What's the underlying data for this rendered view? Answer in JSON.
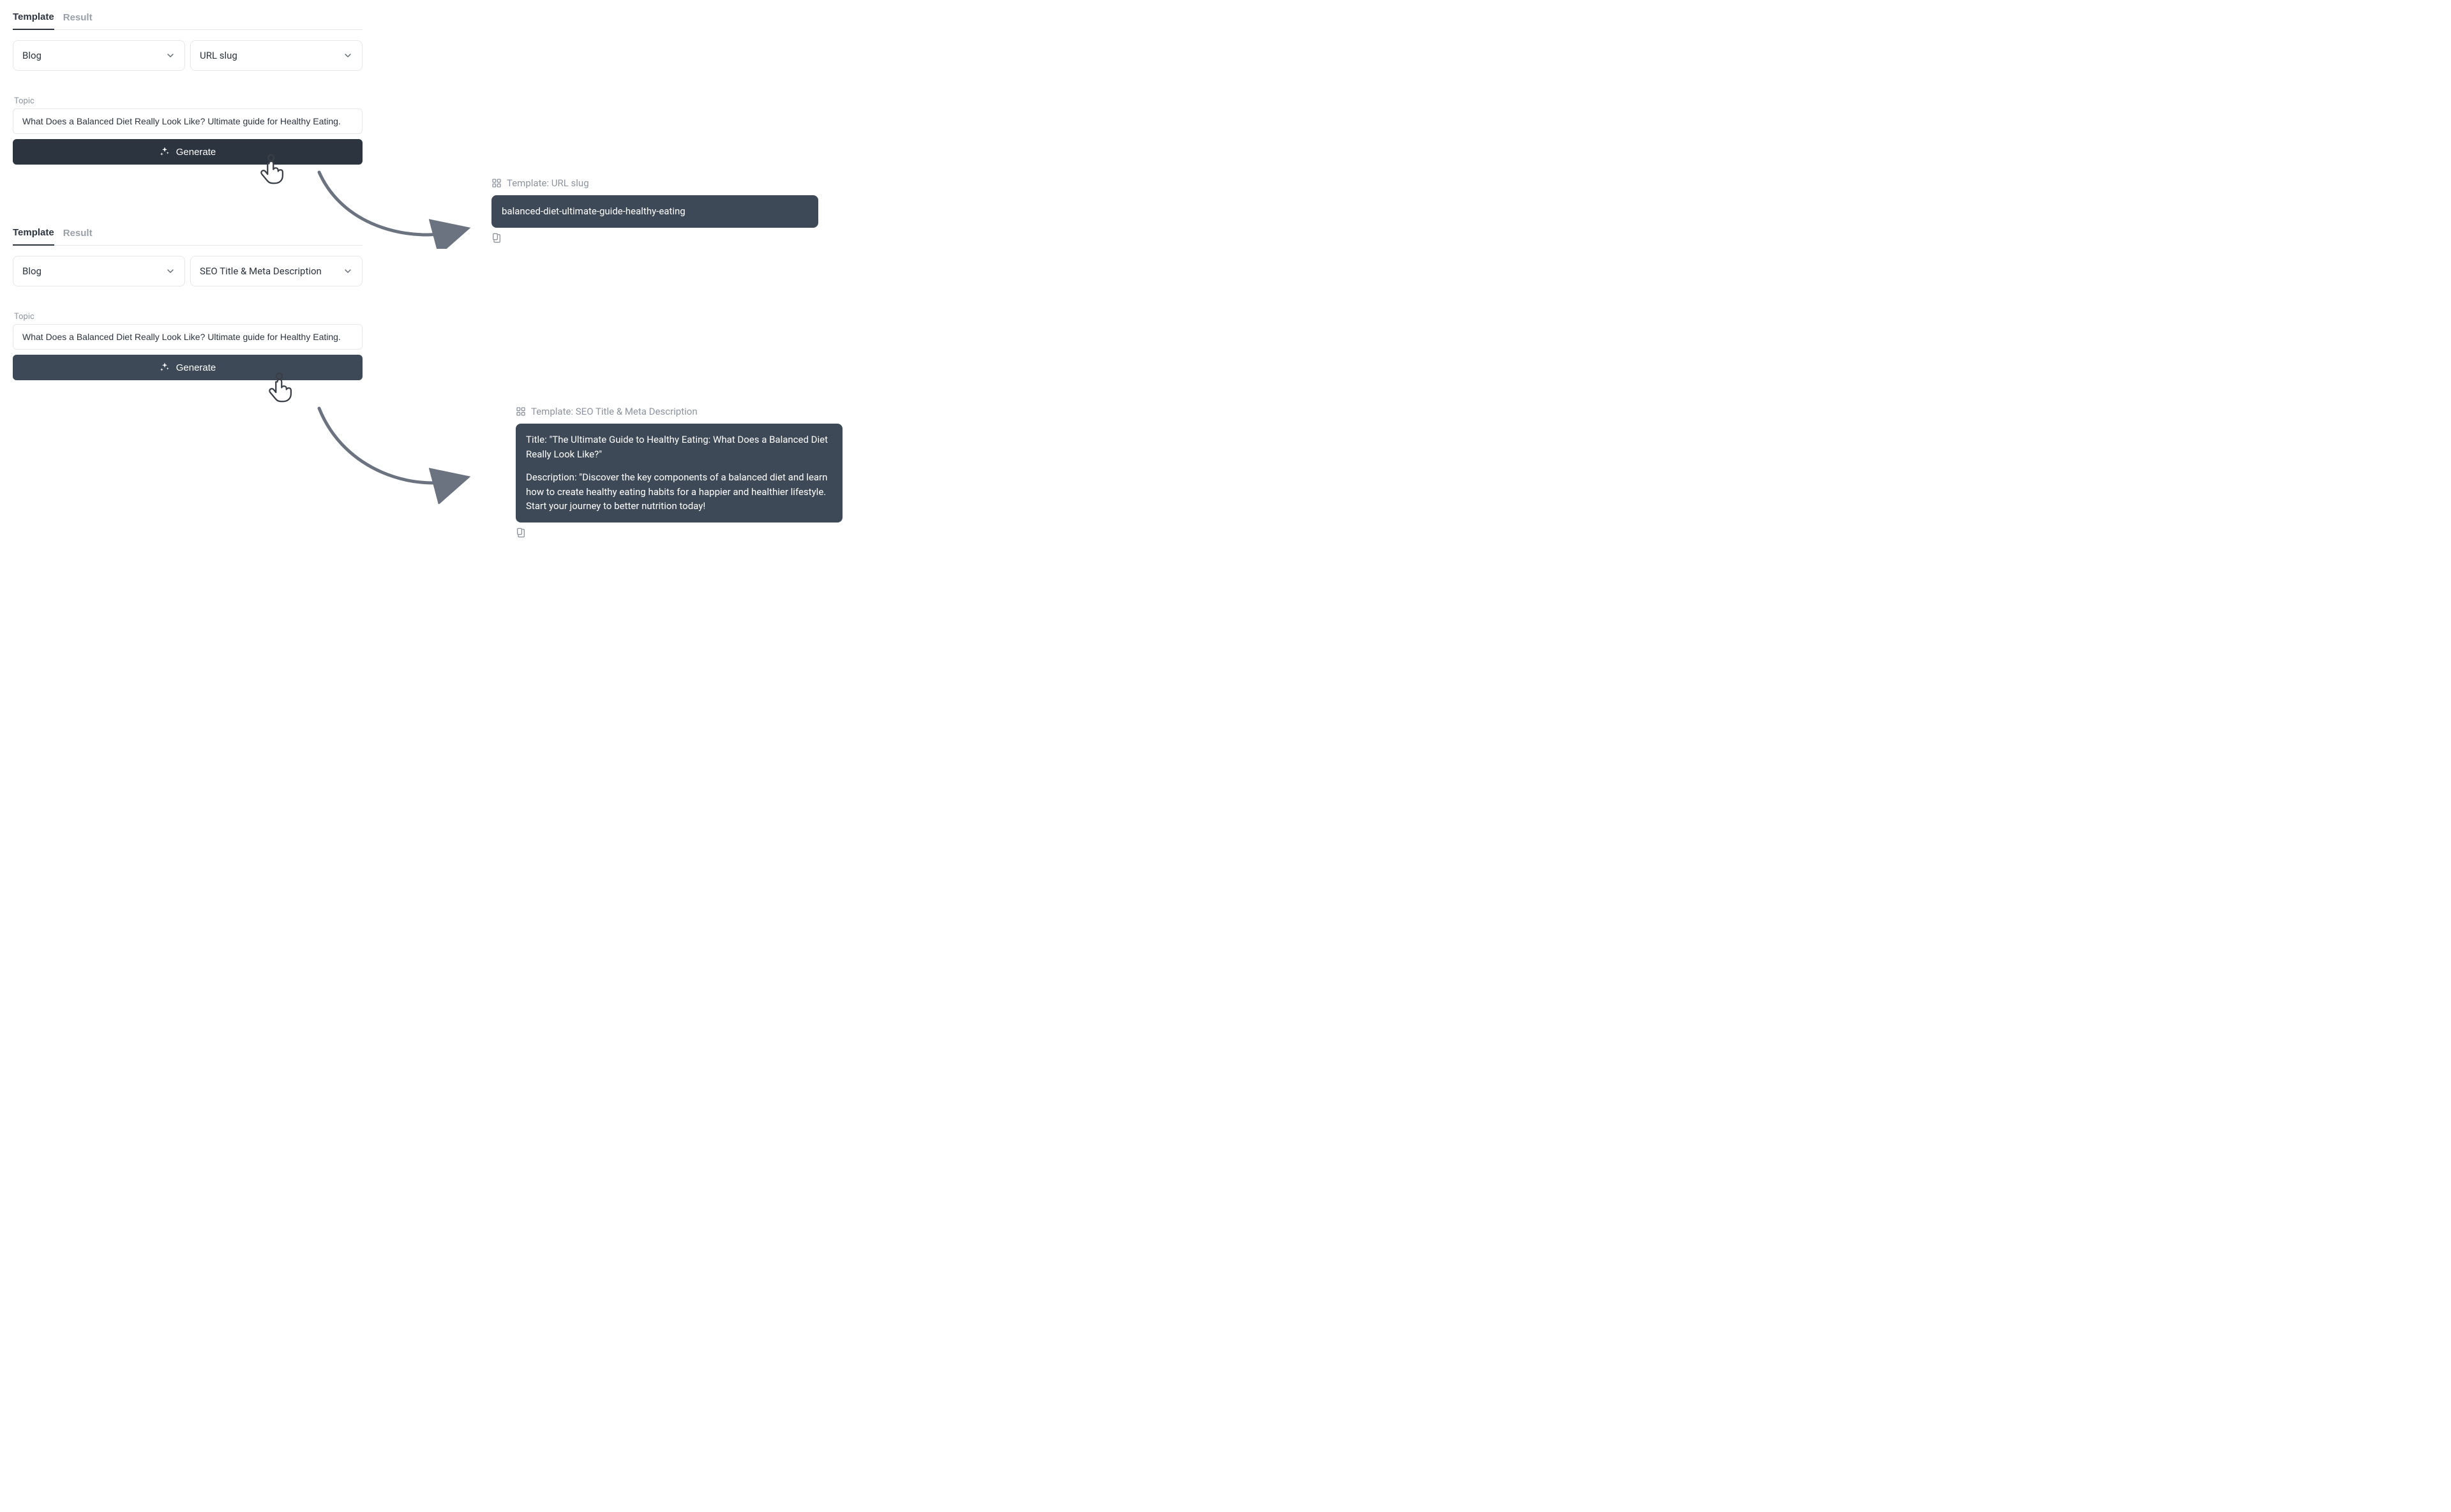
{
  "tabs": {
    "template": "Template",
    "result": "Result"
  },
  "panel1": {
    "select_category": "Blog",
    "select_template": "URL slug",
    "topic_label": "Topic",
    "topic_value": "What Does a Balanced Diet Really Look Like? Ultimate guide for Healthy Eating.",
    "generate": "Generate"
  },
  "panel2": {
    "select_category": "Blog",
    "select_template": "SEO Title & Meta Description",
    "topic_label": "Topic",
    "topic_value": "What Does a Balanced Diet Really Look Like? Ultimate guide for Healthy Eating.",
    "generate": "Generate"
  },
  "result1": {
    "header": "Template: URL slug",
    "body": "balanced-diet-ultimate-guide-healthy-eating"
  },
  "result2": {
    "header": "Template: SEO Title & Meta Description",
    "title_line": "Title: \"The Ultimate Guide to Healthy Eating: What Does a Balanced Diet Really Look Like?\"",
    "desc_line": "Description: \"Discover the key components of a balanced diet and learn how to create healthy eating habits for a happier and healthier lifestyle. Start your journey to better nutrition today!"
  }
}
